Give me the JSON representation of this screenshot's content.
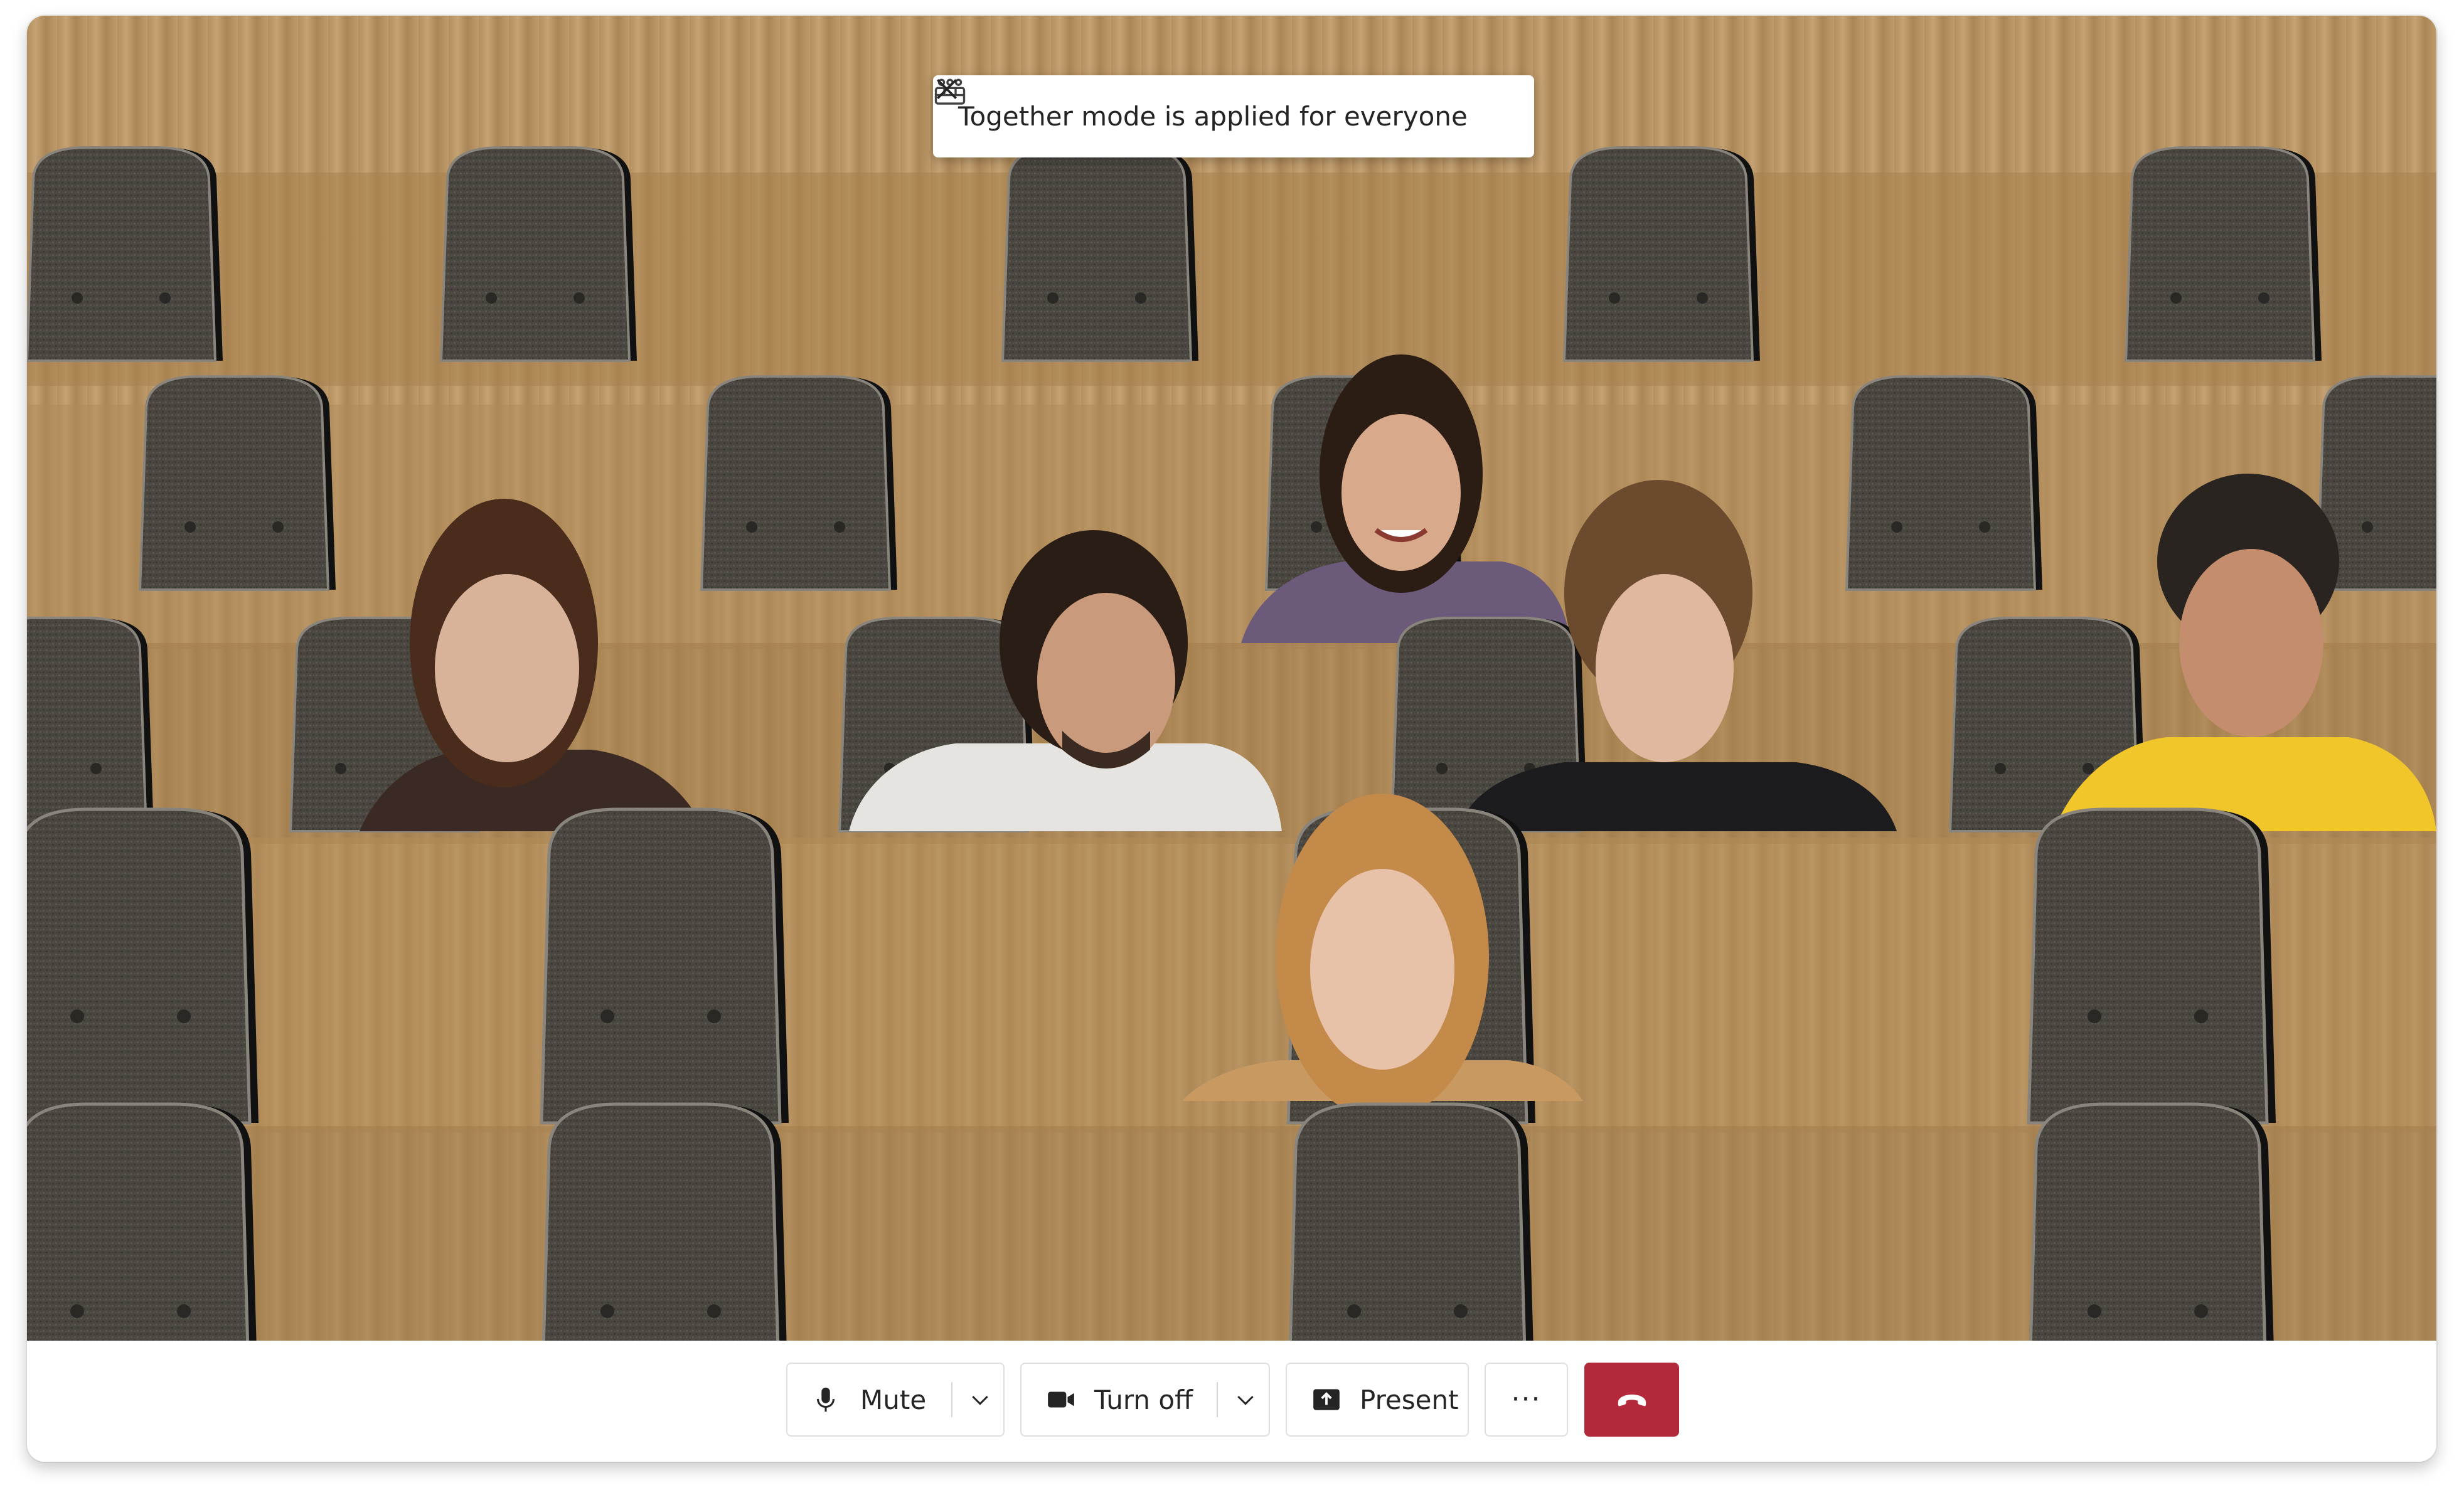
{
  "toast": {
    "icon": "together-mode-icon",
    "message": "Together mode is applied for everyone",
    "close_icon": "close-icon"
  },
  "controls": {
    "mute": {
      "label": "Mute",
      "icon": "microphone-icon"
    },
    "camera": {
      "label": "Turn off",
      "icon": "video-camera-icon"
    },
    "present": {
      "label": "Present",
      "icon": "share-screen-icon"
    },
    "more": {
      "icon": "more-options-icon",
      "glyph": "···"
    },
    "hangup": {
      "icon": "hang-up-icon",
      "color": "#b3283a"
    }
  },
  "participants_count": 6,
  "colors": {
    "background_wood": "#b8935f",
    "seat_fabric": "#4a4640",
    "hangup": "#b3283a"
  }
}
